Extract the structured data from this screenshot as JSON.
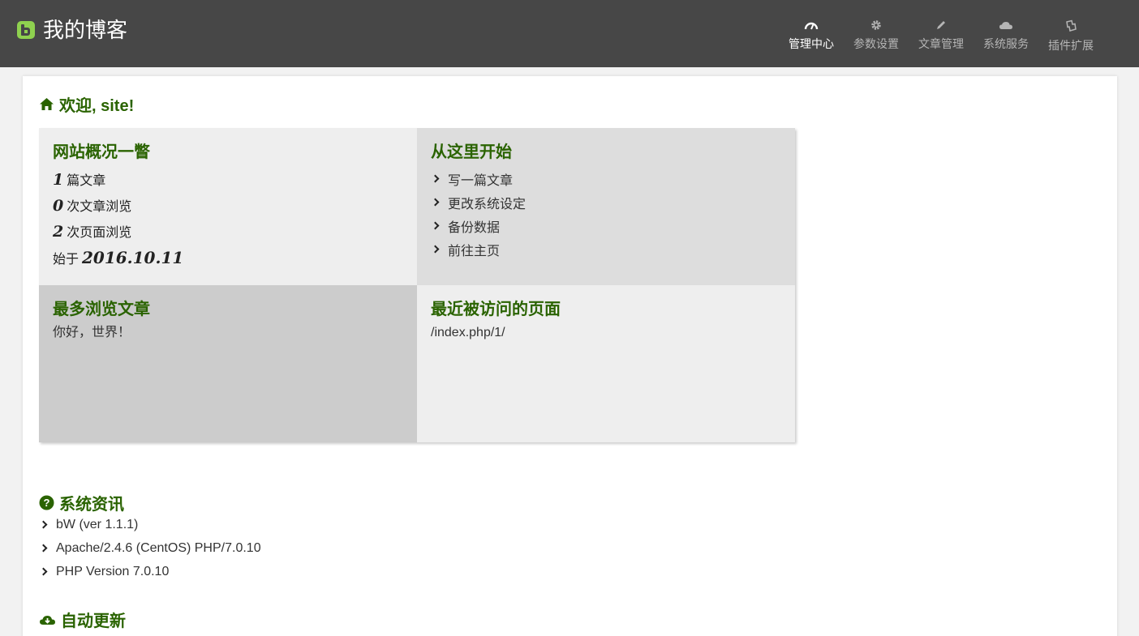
{
  "brand": {
    "title": "我的博客"
  },
  "nav": [
    {
      "label": "管理中心",
      "icon": "dashboard-icon",
      "active": true
    },
    {
      "label": "参数设置",
      "icon": "gear-icon",
      "active": false
    },
    {
      "label": "文章管理",
      "icon": "pencil-icon",
      "active": false
    },
    {
      "label": "系统服务",
      "icon": "cloud-icon",
      "active": false
    },
    {
      "label": "插件扩展",
      "icon": "puzzle-icon",
      "active": false
    }
  ],
  "welcome": {
    "title": "欢迎, site!"
  },
  "overview": {
    "title": "网站概况一瞥",
    "articles": {
      "value": "1",
      "label": "篇文章"
    },
    "article_views": {
      "value": "0",
      "label": "次文章浏览"
    },
    "page_views": {
      "value": "2",
      "label": "次页面浏览"
    },
    "since": {
      "label": "始于",
      "value": "2016.10.11"
    }
  },
  "start": {
    "title": "从这里开始",
    "links": [
      "写一篇文章",
      "更改系统设定",
      "备份数据",
      "前往主页"
    ]
  },
  "most_viewed": {
    "title": "最多浏览文章",
    "item": "你好，世界！"
  },
  "recent_pages": {
    "title": "最近被访问的页面",
    "item": "/index.php/1/"
  },
  "system_info": {
    "title": "系统资讯",
    "items": [
      "bW (ver 1.1.1)",
      "Apache/2.4.6 (CentOS) PHP/7.0.10",
      "PHP Version 7.0.10"
    ]
  },
  "auto_update": {
    "title": "自动更新"
  },
  "colors": {
    "accent": "#2a6300",
    "topbar": "#474747",
    "brand_icon": "#8fd14f"
  }
}
